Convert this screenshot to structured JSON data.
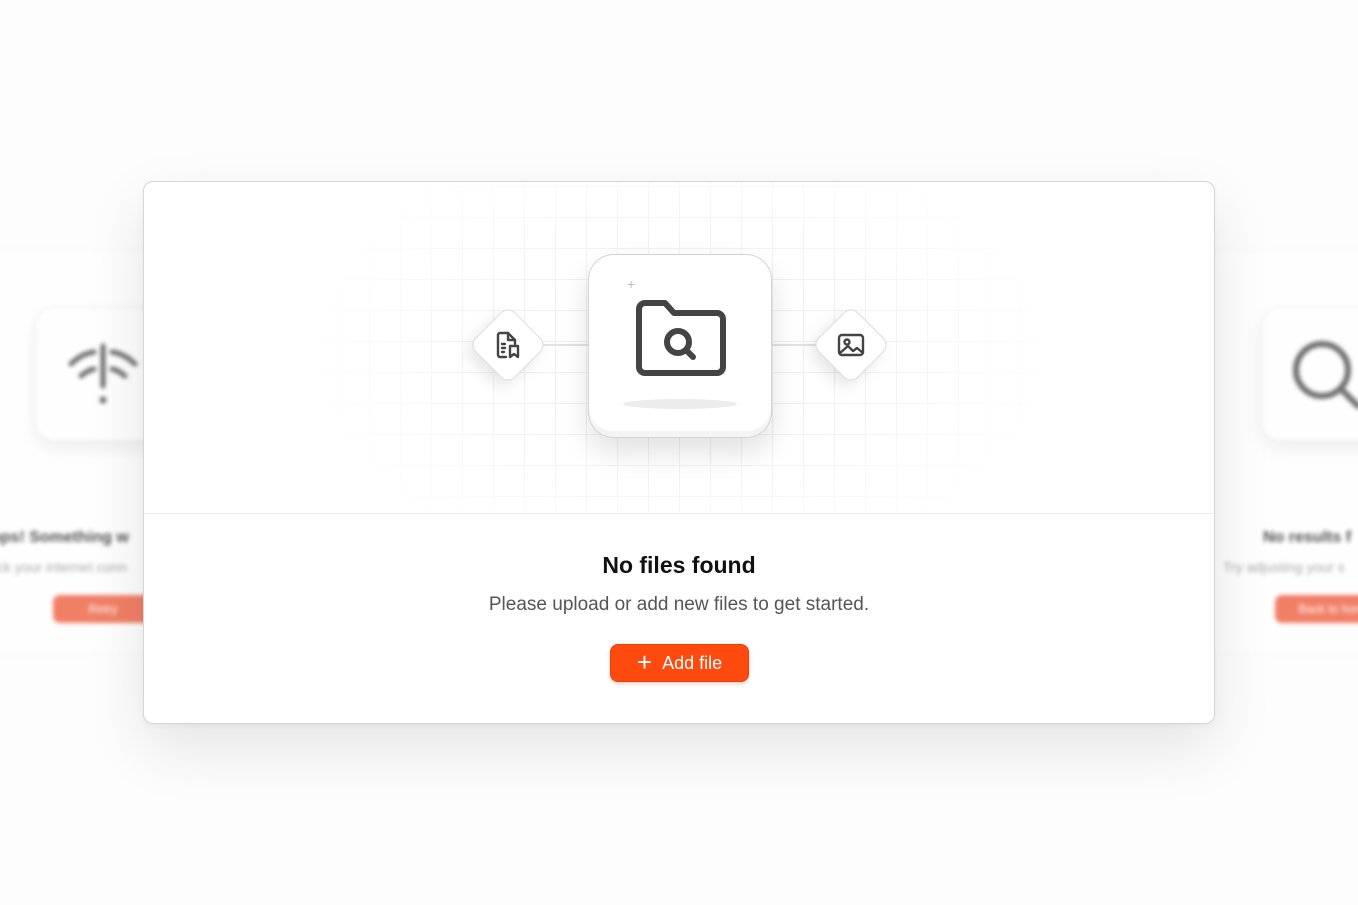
{
  "background_cards": {
    "left": {
      "title": "ops! Something w",
      "subtitle": "ck your internet conn",
      "button": "Retry",
      "icon": "wifi-alert-icon"
    },
    "right": {
      "title": "No results f",
      "subtitle": "Try adjusting your s",
      "button": "Back to hon",
      "icon": "search-icon"
    }
  },
  "empty_state": {
    "title": "No files found",
    "subtitle": "Please upload or add new files to get started.",
    "button_label": "Add file",
    "button_icon": "plus-icon",
    "hero_icons": {
      "left": "document-bookmark-icon",
      "center": "folder-search-icon",
      "right": "image-icon"
    }
  },
  "colors": {
    "accent": "#ff4a0f",
    "background_accent": "#f06a4c",
    "text_primary": "#111111",
    "text_secondary": "#555555",
    "icon": "#444444"
  }
}
